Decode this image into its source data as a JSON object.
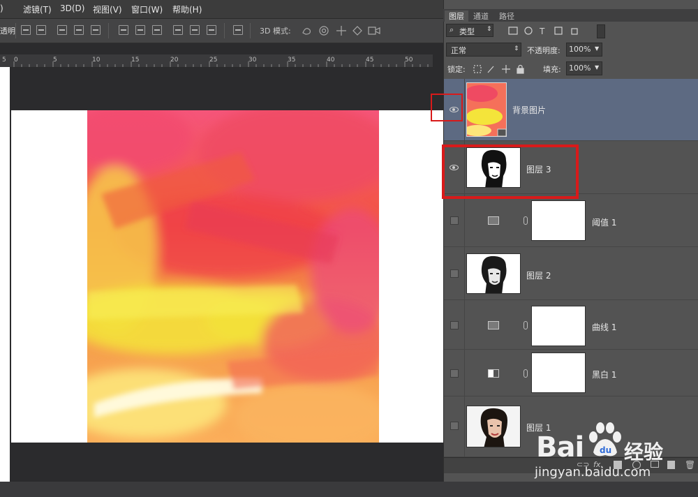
{
  "menu": {
    "items": [
      "滤镜(T)",
      "3D(D)",
      "视图(V)",
      "窗口(W)",
      "帮助(H)"
    ],
    "edge_fragment": ")"
  },
  "options_bar": {
    "left_fragment": "透明",
    "mode_label": "3D 模式:"
  },
  "ruler": {
    "left_value": "5",
    "ticks": [
      "0",
      "5",
      "10",
      "15",
      "20",
      "25",
      "30",
      "35",
      "40",
      "45",
      "50"
    ]
  },
  "layers_panel": {
    "tabs": [
      "图层",
      "通道",
      "路径"
    ],
    "active_tab": "图层",
    "filter_kind": "类型",
    "blend_mode": "正常",
    "opacity_label": "不透明度:",
    "opacity_value": "100%",
    "lock_label": "锁定:",
    "fill_label": "填充:",
    "fill_value": "100%",
    "layers": [
      {
        "name": "背景图片",
        "visible": true,
        "selected": true,
        "type": "image"
      },
      {
        "name": "图层 3",
        "visible": true,
        "selected": false,
        "type": "portrait"
      },
      {
        "name": "阈值 1",
        "visible": false,
        "selected": false,
        "type": "adjustment",
        "icon": "threshold-icon"
      },
      {
        "name": "图层 2",
        "visible": false,
        "selected": false,
        "type": "portrait"
      },
      {
        "name": "曲线 1",
        "visible": false,
        "selected": false,
        "type": "adjustment",
        "icon": "curves-icon"
      },
      {
        "name": "黑白 1",
        "visible": false,
        "selected": false,
        "type": "adjustment",
        "icon": "black-white-icon"
      },
      {
        "name": "图层 1",
        "visible": false,
        "selected": false,
        "type": "photo"
      }
    ],
    "bottom_fragment": "fx."
  },
  "watermark": {
    "brand": "Bai",
    "brand_suffix": "经验",
    "url": "jingyan.baidu.com"
  },
  "colors": {
    "selected_layer": "#5d6a82",
    "highlight": "#d81a1a",
    "panel_bg": "#535353"
  }
}
